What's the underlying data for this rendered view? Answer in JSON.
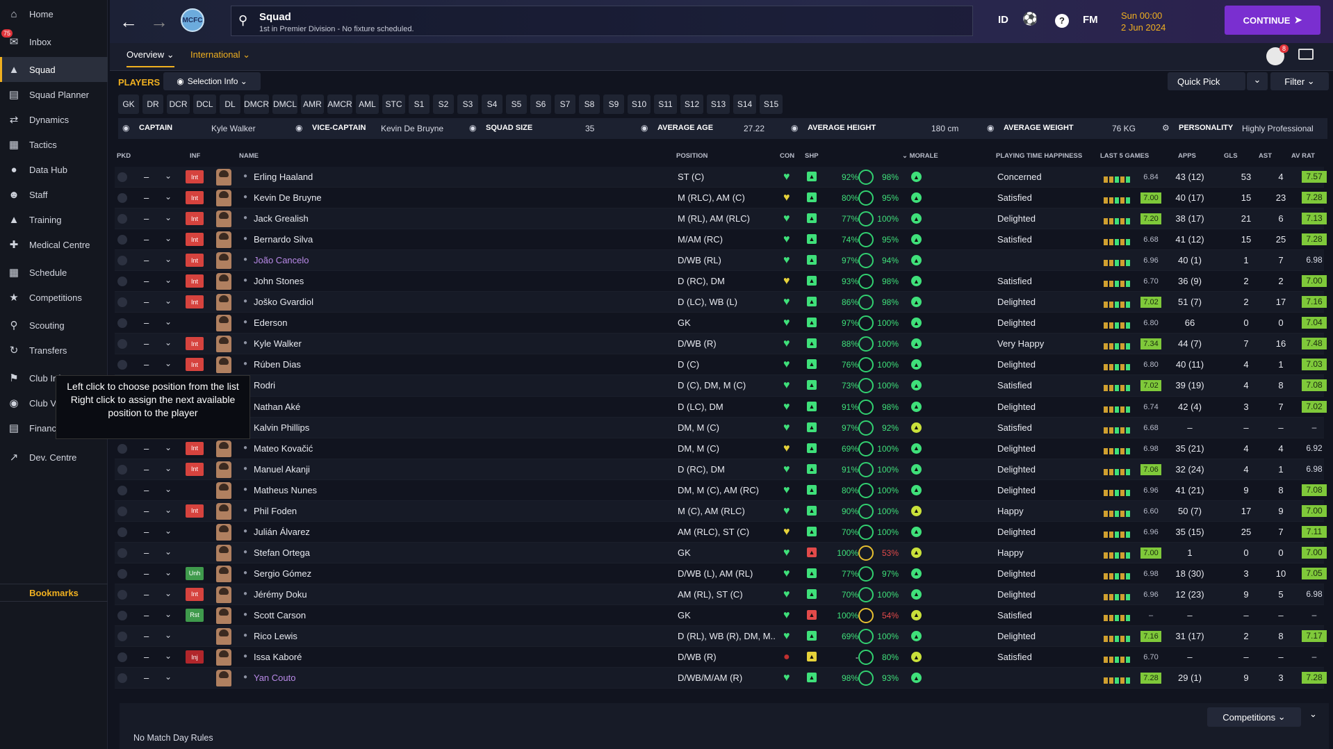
{
  "sidebar": {
    "items": [
      {
        "label": "Home",
        "icon": "home-icon"
      },
      {
        "label": "Inbox",
        "icon": "inbox-icon",
        "badge": "75"
      },
      {
        "label": "Squad",
        "icon": "shirt-icon",
        "active": true
      },
      {
        "label": "Squad Planner",
        "icon": "planner-icon"
      },
      {
        "label": "Dynamics",
        "icon": "dynamics-icon"
      },
      {
        "label": "Tactics",
        "icon": "tactics-icon"
      },
      {
        "label": "Data Hub",
        "icon": "data-hub-icon"
      },
      {
        "label": "Staff",
        "icon": "staff-icon"
      },
      {
        "label": "Training",
        "icon": "training-icon"
      },
      {
        "label": "Medical Centre",
        "icon": "medical-icon"
      },
      {
        "label": "Schedule",
        "icon": "calendar-icon"
      },
      {
        "label": "Competitions",
        "icon": "trophy-icon"
      },
      {
        "label": "Scouting",
        "icon": "scouting-icon"
      },
      {
        "label": "Transfers",
        "icon": "transfers-icon"
      },
      {
        "label": "Club Info",
        "icon": "club-info-icon"
      },
      {
        "label": "Club Vision",
        "icon": "club-vision-icon"
      },
      {
        "label": "Finances",
        "icon": "finances-icon"
      },
      {
        "label": "Dev. Centre",
        "icon": "dev-centre-icon"
      }
    ],
    "bookmarks": "Bookmarks"
  },
  "header": {
    "title": "Squad",
    "subtitle": "1st in Premier Division - No fixture scheduled.",
    "id_label": "ID",
    "fm_label": "FM",
    "date_line1": "Sun 00:00",
    "date_line2": "2 Jun 2024",
    "continue_label": "CONTINUE",
    "notif_count": "8"
  },
  "subnav": {
    "tabs": [
      "Overview",
      "International"
    ]
  },
  "toolbar": {
    "players_label": "PLAYERS",
    "selection_info": "Selection Info",
    "quick_pick": "Quick Pick",
    "filter": "Filter"
  },
  "positions": [
    "GK",
    "DR",
    "DCR",
    "DCL",
    "DL",
    "DMCR",
    "DMCL",
    "AMR",
    "AMCR",
    "AML",
    "STC",
    "S1",
    "S2",
    "S3",
    "S4",
    "S5",
    "S6",
    "S7",
    "S8",
    "S9",
    "S10",
    "S11",
    "S12",
    "S13",
    "S14",
    "S15"
  ],
  "infobar": {
    "captain_label": "CAPTAIN",
    "captain": "Kyle Walker",
    "vice_label": "VICE-CAPTAIN",
    "vice": "Kevin De Bruyne",
    "squad_size_label": "SQUAD SIZE",
    "squad_size": "35",
    "avg_age_label": "AVERAGE AGE",
    "avg_age": "27.22",
    "avg_height_label": "AVERAGE HEIGHT",
    "avg_height": "180 cm",
    "avg_weight_label": "AVERAGE WEIGHT",
    "avg_weight": "76 KG",
    "personality_label": "PERSONALITY",
    "personality": "Highly Professional"
  },
  "columns": {
    "pkd": "PKD",
    "inf": "INF",
    "name": "NAME",
    "position": "POSITION",
    "con": "CON",
    "shp": "SHP",
    "morale": "MORALE",
    "pth": "PLAYING TIME HAPPINESS",
    "last5": "LAST 5 GAMES",
    "apps": "APPS",
    "gls": "GLS",
    "ast": "AST",
    "avrat": "AV RAT"
  },
  "players": [
    {
      "inf": "Int",
      "name": "Erling Haaland",
      "position": "ST (C)",
      "pct1": "92%",
      "pct2": "98%",
      "pth": "Concerned",
      "rat": "6.84",
      "apps": "43 (12)",
      "gls": "53",
      "ast": "4",
      "avrat": "7.57"
    },
    {
      "inf": "Int",
      "name": "Kevin De Bruyne",
      "position": "M (RLC), AM (C)",
      "pct1": "80%",
      "pct2": "95%",
      "pth": "Satisfied",
      "rat": "7.00",
      "apps": "40 (17)",
      "gls": "15",
      "ast": "23",
      "avrat": "7.28"
    },
    {
      "inf": "Int",
      "name": "Jack Grealish",
      "position": "M (RL), AM (RLC)",
      "pct1": "77%",
      "pct2": "100%",
      "pth": "Delighted",
      "rat": "7.20",
      "apps": "38 (17)",
      "gls": "21",
      "ast": "6",
      "avrat": "7.13"
    },
    {
      "inf": "Int",
      "name": "Bernardo Silva",
      "position": "M/AM (RC)",
      "pct1": "74%",
      "pct2": "95%",
      "pth": "Satisfied",
      "rat": "6.68",
      "apps": "41 (12)",
      "gls": "15",
      "ast": "25",
      "avrat": "7.28"
    },
    {
      "inf": "Int",
      "name": "João Cancelo",
      "position": "D/WB (RL)",
      "pct1": "97%",
      "pct2": "94%",
      "pth": "",
      "rat": "6.96",
      "apps": "40 (1)",
      "gls": "1",
      "ast": "7",
      "avrat": "6.98"
    },
    {
      "inf": "Int",
      "name": "John Stones",
      "position": "D (RC), DM",
      "pct1": "93%",
      "pct2": "98%",
      "pth": "Satisfied",
      "rat": "6.70",
      "apps": "36 (9)",
      "gls": "2",
      "ast": "2",
      "avrat": "7.00"
    },
    {
      "inf": "Int",
      "name": "Joško Gvardiol",
      "position": "D (LC), WB (L)",
      "pct1": "86%",
      "pct2": "98%",
      "pth": "Delighted",
      "rat": "7.02",
      "apps": "51 (7)",
      "gls": "2",
      "ast": "17",
      "avrat": "7.16"
    },
    {
      "inf": "",
      "name": "Ederson",
      "position": "GK",
      "pct1": "97%",
      "pct2": "100%",
      "pth": "Delighted",
      "rat": "6.80",
      "apps": "66",
      "gls": "0",
      "ast": "0",
      "avrat": "7.04"
    },
    {
      "inf": "Int",
      "name": "Kyle Walker",
      "position": "D/WB (R)",
      "pct1": "88%",
      "pct2": "100%",
      "pth": "Very Happy",
      "rat": "7.34",
      "apps": "44 (7)",
      "gls": "7",
      "ast": "16",
      "avrat": "7.48"
    },
    {
      "inf": "Int",
      "name": "Rúben Dias",
      "position": "D (C)",
      "pct1": "76%",
      "pct2": "100%",
      "pth": "Delighted",
      "rat": "6.80",
      "apps": "40 (11)",
      "gls": "4",
      "ast": "1",
      "avrat": "7.03"
    },
    {
      "inf": "",
      "name": "Rodri",
      "position": "D (C), DM, M (C)",
      "pct1": "73%",
      "pct2": "100%",
      "pth": "Satisfied",
      "rat": "7.02",
      "apps": "39 (19)",
      "gls": "4",
      "ast": "8",
      "avrat": "7.08"
    },
    {
      "inf": "",
      "name": "Nathan Aké",
      "position": "D (LC), DM",
      "pct1": "91%",
      "pct2": "98%",
      "pth": "Delighted",
      "rat": "6.74",
      "apps": "42 (4)",
      "gls": "3",
      "ast": "7",
      "avrat": "7.02"
    },
    {
      "inf": "",
      "name": "Kalvin Phillips",
      "position": "DM, M (C)",
      "pct1": "97%",
      "pct2": "92%",
      "pth": "Satisfied",
      "rat": "6.68",
      "apps": "–",
      "gls": "–",
      "ast": "–",
      "avrat": "–"
    },
    {
      "inf": "Int",
      "name": "Mateo Kovačić",
      "position": "DM, M (C)",
      "pct1": "69%",
      "pct2": "100%",
      "pth": "Delighted",
      "rat": "6.98",
      "apps": "35 (21)",
      "gls": "4",
      "ast": "4",
      "avrat": "6.92"
    },
    {
      "inf": "Int",
      "name": "Manuel Akanji",
      "position": "D (RC), DM",
      "pct1": "91%",
      "pct2": "100%",
      "pth": "Delighted",
      "rat": "7.06",
      "apps": "32 (24)",
      "gls": "4",
      "ast": "1",
      "avrat": "6.98"
    },
    {
      "inf": "",
      "name": "Matheus Nunes",
      "position": "DM, M (C), AM (RC)",
      "pct1": "80%",
      "pct2": "100%",
      "pth": "Delighted",
      "rat": "6.96",
      "apps": "41 (21)",
      "gls": "9",
      "ast": "8",
      "avrat": "7.08"
    },
    {
      "inf": "Int",
      "name": "Phil Foden",
      "position": "M (C), AM (RLC)",
      "pct1": "90%",
      "pct2": "100%",
      "pth": "Happy",
      "rat": "6.60",
      "apps": "50 (7)",
      "gls": "17",
      "ast": "9",
      "avrat": "7.00"
    },
    {
      "inf": "",
      "name": "Julián Álvarez",
      "position": "AM (RLC), ST (C)",
      "pct1": "70%",
      "pct2": "100%",
      "pth": "Delighted",
      "rat": "6.96",
      "apps": "35 (15)",
      "gls": "25",
      "ast": "7",
      "avrat": "7.11"
    },
    {
      "inf": "",
      "name": "Stefan Ortega",
      "position": "GK",
      "pct1": "100%",
      "pct2": "53%",
      "pth": "Happy",
      "rat": "7.00",
      "apps": "1",
      "gls": "0",
      "ast": "0",
      "avrat": "7.00"
    },
    {
      "inf": "Unh",
      "name": "Sergio Gómez",
      "position": "D/WB (L), AM (RL)",
      "pct1": "77%",
      "pct2": "97%",
      "pth": "Delighted",
      "rat": "6.98",
      "apps": "18 (30)",
      "gls": "3",
      "ast": "10",
      "avrat": "7.05"
    },
    {
      "inf": "Int",
      "name": "Jérémy Doku",
      "position": "AM (RL), ST (C)",
      "pct1": "70%",
      "pct2": "100%",
      "pth": "Delighted",
      "rat": "6.96",
      "apps": "12 (23)",
      "gls": "9",
      "ast": "5",
      "avrat": "6.98"
    },
    {
      "inf": "Rst",
      "name": "Scott Carson",
      "position": "GK",
      "pct1": "100%",
      "pct2": "54%",
      "pth": "Satisfied",
      "rat": "–",
      "apps": "–",
      "gls": "–",
      "ast": "–",
      "avrat": "–"
    },
    {
      "inf": "",
      "name": "Rico Lewis",
      "position": "D (RL), WB (R), DM, M...",
      "pct1": "69%",
      "pct2": "100%",
      "pth": "Delighted",
      "rat": "7.16",
      "apps": "31 (17)",
      "gls": "2",
      "ast": "8",
      "avrat": "7.17"
    },
    {
      "inf": "Inj",
      "name": "Issa Kaboré",
      "position": "D/WB (R)",
      "pct1": "-",
      "pct2": "80%",
      "pth": "Satisfied",
      "rat": "6.70",
      "apps": "–",
      "gls": "–",
      "ast": "–",
      "avrat": "–"
    },
    {
      "inf": "",
      "name": "Yan Couto",
      "position": "D/WB/M/AM (R)",
      "pct1": "98%",
      "pct2": "93%",
      "pth": "",
      "rat": "7.28",
      "apps": "29 (1)",
      "gls": "9",
      "ast": "3",
      "avrat": "7.28"
    }
  ],
  "tooltip": {
    "line1": "Left click to choose position from the list",
    "line2": "Right click to assign the next available position to the player"
  },
  "bottom": {
    "competitions": "Competitions",
    "no_match": "No Match Day Rules"
  },
  "colors": {
    "accent": "#f0b020",
    "continue": "#7a2fd0",
    "int_badge": "#d6433e",
    "good": "#32d070"
  }
}
